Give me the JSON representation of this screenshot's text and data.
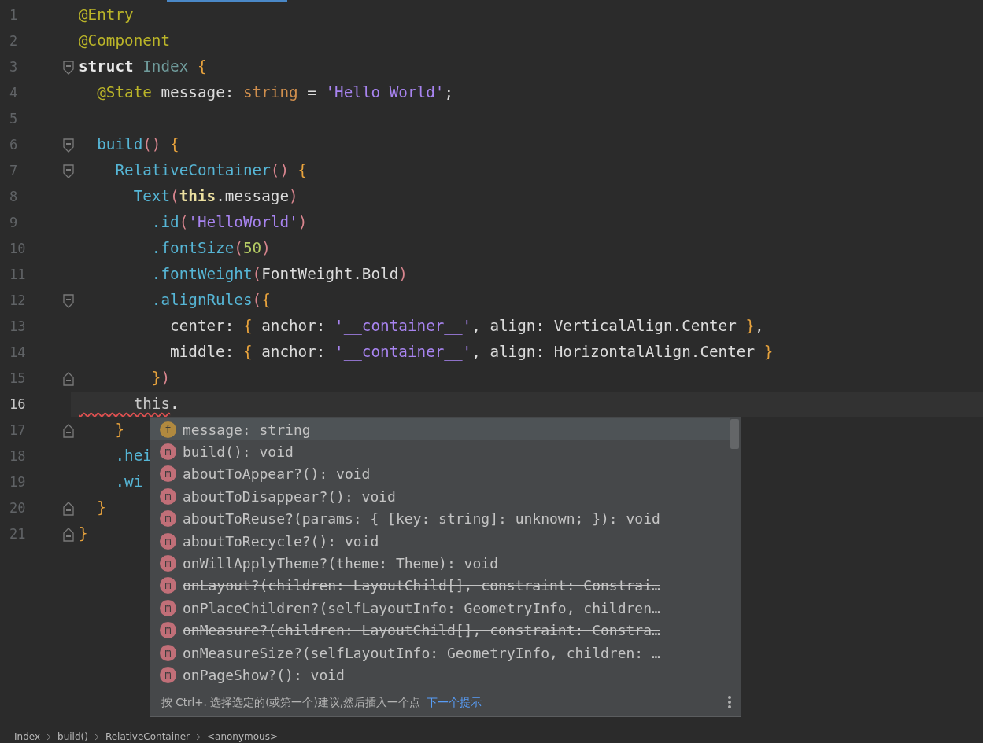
{
  "editor": {
    "lines": [
      {
        "number": "1",
        "current": false,
        "tokens": [
          {
            "kind": "annotation",
            "text": "@Entry"
          }
        ]
      },
      {
        "number": "2",
        "current": false,
        "tokens": [
          {
            "kind": "annotation",
            "text": "@Component"
          }
        ]
      },
      {
        "number": "3",
        "current": false,
        "fold_open": true,
        "tokens": [
          {
            "kind": "keyword",
            "text": "struct"
          },
          {
            "kind": "type",
            "text": " Index"
          },
          {
            "kind": "brace",
            "text": " {"
          }
        ]
      },
      {
        "number": "4",
        "current": false,
        "tokens": [
          {
            "kind": "annotation",
            "text": "  @State"
          },
          {
            "kind": "plain",
            "text": " message: "
          },
          {
            "kind": "typekw",
            "text": "string"
          },
          {
            "kind": "plain",
            "text": " = "
          },
          {
            "kind": "string",
            "text": "'Hello World'"
          },
          {
            "kind": "plain",
            "text": ";"
          }
        ]
      },
      {
        "number": "5",
        "current": false
      },
      {
        "number": "6",
        "current": false,
        "fold_open": true,
        "tokens": [
          {
            "kind": "func",
            "text": "  build"
          },
          {
            "kind": "paren",
            "text": "()"
          },
          {
            "kind": "brace",
            "text": " {"
          }
        ]
      },
      {
        "number": "7",
        "current": false,
        "fold_open": true,
        "tokens": [
          {
            "kind": "func",
            "text": "    RelativeContainer"
          },
          {
            "kind": "paren",
            "text": "()"
          },
          {
            "kind": "brace",
            "text": " {"
          }
        ]
      },
      {
        "number": "8",
        "current": false,
        "tokens": [
          {
            "kind": "func",
            "text": "      Text"
          },
          {
            "kind": "paren",
            "text": "("
          },
          {
            "kind": "this",
            "text": "this"
          },
          {
            "kind": "plain",
            "text": ".message"
          },
          {
            "kind": "paren",
            "text": ")"
          }
        ]
      },
      {
        "number": "9",
        "current": false,
        "tokens": [
          {
            "kind": "func",
            "text": "        .id"
          },
          {
            "kind": "paren",
            "text": "("
          },
          {
            "kind": "string",
            "text": "'HelloWorld'"
          },
          {
            "kind": "paren",
            "text": ")"
          }
        ]
      },
      {
        "number": "10",
        "current": false,
        "tokens": [
          {
            "kind": "func",
            "text": "        .fontSize"
          },
          {
            "kind": "paren",
            "text": "("
          },
          {
            "kind": "number",
            "text": "50"
          },
          {
            "kind": "paren",
            "text": ")"
          }
        ]
      },
      {
        "number": "11",
        "current": false,
        "tokens": [
          {
            "kind": "func",
            "text": "        .fontWeight"
          },
          {
            "kind": "paren",
            "text": "("
          },
          {
            "kind": "plain",
            "text": "FontWeight.Bold"
          },
          {
            "kind": "paren",
            "text": ")"
          }
        ]
      },
      {
        "number": "12",
        "current": false,
        "fold_open": true,
        "tokens": [
          {
            "kind": "func",
            "text": "        .alignRules"
          },
          {
            "kind": "paren",
            "text": "("
          },
          {
            "kind": "brace",
            "text": "{"
          }
        ]
      },
      {
        "number": "13",
        "current": false,
        "tokens": [
          {
            "kind": "plain",
            "text": "          center: "
          },
          {
            "kind": "brace",
            "text": "{"
          },
          {
            "kind": "plain",
            "text": " anchor: "
          },
          {
            "kind": "string",
            "text": "'__container__'"
          },
          {
            "kind": "plain",
            "text": ", align: VerticalAlign.Center "
          },
          {
            "kind": "brace",
            "text": "}"
          },
          {
            "kind": "plain",
            "text": ","
          }
        ]
      },
      {
        "number": "14",
        "current": false,
        "tokens": [
          {
            "kind": "plain",
            "text": "          middle: "
          },
          {
            "kind": "brace",
            "text": "{"
          },
          {
            "kind": "plain",
            "text": " anchor: "
          },
          {
            "kind": "string",
            "text": "'__container__'"
          },
          {
            "kind": "plain",
            "text": ", align: HorizontalAlign.Center "
          },
          {
            "kind": "brace",
            "text": "}"
          }
        ]
      },
      {
        "number": "15",
        "current": false,
        "fold_open": false,
        "tokens": [
          {
            "kind": "brace",
            "text": "        }"
          },
          {
            "kind": "paren",
            "text": ")"
          }
        ]
      },
      {
        "number": "16",
        "current": true,
        "tokens": [
          {
            "kind": "this-error",
            "text": "      this"
          },
          {
            "kind": "plain",
            "text": "."
          }
        ]
      },
      {
        "number": "17",
        "current": false,
        "fold_open": false,
        "tokens": [
          {
            "kind": "brace",
            "text": "    }"
          }
        ]
      },
      {
        "number": "18",
        "current": false,
        "tokens": [
          {
            "kind": "func",
            "text": "    .hei"
          }
        ]
      },
      {
        "number": "19",
        "current": false,
        "tokens": [
          {
            "kind": "func",
            "text": "    .wi"
          }
        ]
      },
      {
        "number": "20",
        "current": false,
        "fold_open": false,
        "tokens": [
          {
            "kind": "brace",
            "text": "  }"
          }
        ]
      },
      {
        "number": "21",
        "current": false,
        "fold_open": false,
        "tokens": [
          {
            "kind": "brace",
            "text": "}"
          }
        ]
      }
    ]
  },
  "completion": {
    "items": [
      {
        "kind": "field",
        "icon": "f",
        "text": "message: string",
        "deprecated": false,
        "selected": true
      },
      {
        "kind": "method",
        "icon": "m",
        "text": "build(): void",
        "deprecated": false,
        "selected": false
      },
      {
        "kind": "method",
        "icon": "m",
        "text": "aboutToAppear?(): void",
        "deprecated": false,
        "selected": false
      },
      {
        "kind": "method",
        "icon": "m",
        "text": "aboutToDisappear?(): void",
        "deprecated": false,
        "selected": false
      },
      {
        "kind": "method",
        "icon": "m",
        "text": "aboutToReuse?(params: { [key: string]: unknown; }): void",
        "deprecated": false,
        "selected": false
      },
      {
        "kind": "method",
        "icon": "m",
        "text": "aboutToRecycle?(): void",
        "deprecated": false,
        "selected": false
      },
      {
        "kind": "method",
        "icon": "m",
        "text": "onWillApplyTheme?(theme: Theme): void",
        "deprecated": false,
        "selected": false
      },
      {
        "kind": "method",
        "icon": "m",
        "text": "onLayout?(children: LayoutChild[], constraint: Constrai…",
        "deprecated": true,
        "selected": false
      },
      {
        "kind": "method",
        "icon": "m",
        "text": "onPlaceChildren?(selfLayoutInfo: GeometryInfo, children…",
        "deprecated": false,
        "selected": false
      },
      {
        "kind": "method",
        "icon": "m",
        "text": "onMeasure?(children: LayoutChild[], constraint: Constra…",
        "deprecated": true,
        "selected": false
      },
      {
        "kind": "method",
        "icon": "m",
        "text": "onMeasureSize?(selfLayoutInfo: GeometryInfo, children: …",
        "deprecated": false,
        "selected": false
      },
      {
        "kind": "method",
        "icon": "m",
        "text": "onPageShow?(): void",
        "deprecated": false,
        "selected": false
      }
    ],
    "hint": "按 Ctrl+. 选择选定的(或第一个)建议,然后插入一个点",
    "hint_link": "下一个提示"
  },
  "breadcrumbs": [
    "Index",
    "build()",
    "RelativeContainer",
    "<anonymous>"
  ]
}
